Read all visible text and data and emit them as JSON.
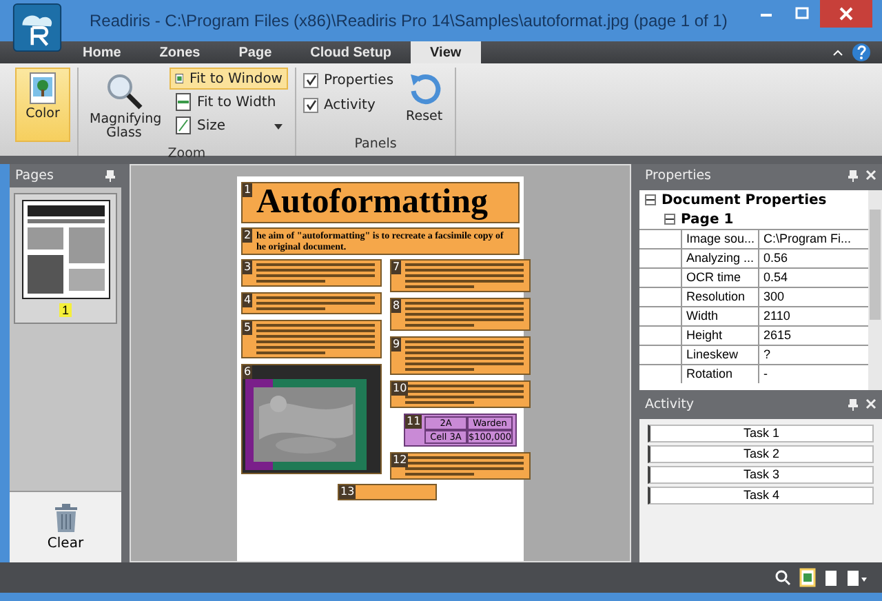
{
  "window": {
    "title": "Readiris - C:\\Program Files (x86)\\Readiris Pro 14\\Samples\\autoformat.jpg (page 1 of 1)"
  },
  "tabs": [
    {
      "label": "Home",
      "selected": false
    },
    {
      "label": "Zones",
      "selected": false
    },
    {
      "label": "Page",
      "selected": false
    },
    {
      "label": "Cloud Setup",
      "selected": false
    },
    {
      "label": "View",
      "selected": true
    }
  ],
  "ribbon": {
    "color_button": {
      "label": "Color",
      "selected": true
    },
    "zoom_group": {
      "label": "Zoom",
      "magnifier": "Magnifying Glass",
      "options": [
        {
          "label": "Fit to Window",
          "selected": true,
          "kind": "window"
        },
        {
          "label": "Fit to Width",
          "selected": false,
          "kind": "width"
        },
        {
          "label": "Size",
          "selected": false,
          "kind": "size"
        }
      ]
    },
    "panels_group": {
      "label": "Panels",
      "checkboxes": [
        {
          "label": "Properties",
          "checked": true
        },
        {
          "label": "Activity",
          "checked": true
        }
      ],
      "reset": "Reset"
    }
  },
  "pages_pane": {
    "title": "Pages",
    "thumbnails": [
      {
        "number": "1",
        "selected": true
      }
    ],
    "clear": "Clear"
  },
  "document": {
    "title_zone": {
      "number": "1",
      "text": "Autoformatting"
    },
    "intro_zone": {
      "number": "2",
      "lines": [
        "he aim of \"autoformatting\" is to recreate a facsimile copy of",
        "he original document."
      ]
    },
    "left_column": [
      {
        "number": "3",
        "kind": "text"
      },
      {
        "number": "4",
        "kind": "text"
      },
      {
        "number": "5",
        "kind": "text"
      },
      {
        "number": "6",
        "kind": "picture"
      }
    ],
    "right_column": [
      {
        "number": "7",
        "kind": "text"
      },
      {
        "number": "8",
        "kind": "text"
      },
      {
        "number": "9",
        "kind": "text"
      },
      {
        "number": "10",
        "kind": "text"
      },
      {
        "number": "11",
        "kind": "table",
        "cells": [
          [
            "2A",
            "Warden"
          ],
          [
            "Cell 3A",
            "$100,000"
          ]
        ]
      },
      {
        "number": "12",
        "kind": "text"
      }
    ],
    "footer_zone": {
      "number": "13"
    }
  },
  "properties": {
    "title": "Properties",
    "tree": [
      {
        "label": "Document Properties",
        "expanded": true,
        "children": [
          {
            "label": "Page 1",
            "expanded": true,
            "rows": [
              [
                "Image sou...",
                "C:\\Program Fi..."
              ],
              [
                "Analyzing ...",
                "0.56"
              ],
              [
                "OCR time",
                "0.54"
              ],
              [
                "Resolution",
                "300"
              ],
              [
                "Width",
                "2110"
              ],
              [
                "Height",
                "2615"
              ],
              [
                "Lineskew",
                "?"
              ],
              [
                "Rotation",
                "-"
              ]
            ]
          }
        ]
      }
    ]
  },
  "activity": {
    "title": "Activity",
    "tasks": [
      "Task 1",
      "Task 2",
      "Task 3",
      "Task 4"
    ]
  }
}
